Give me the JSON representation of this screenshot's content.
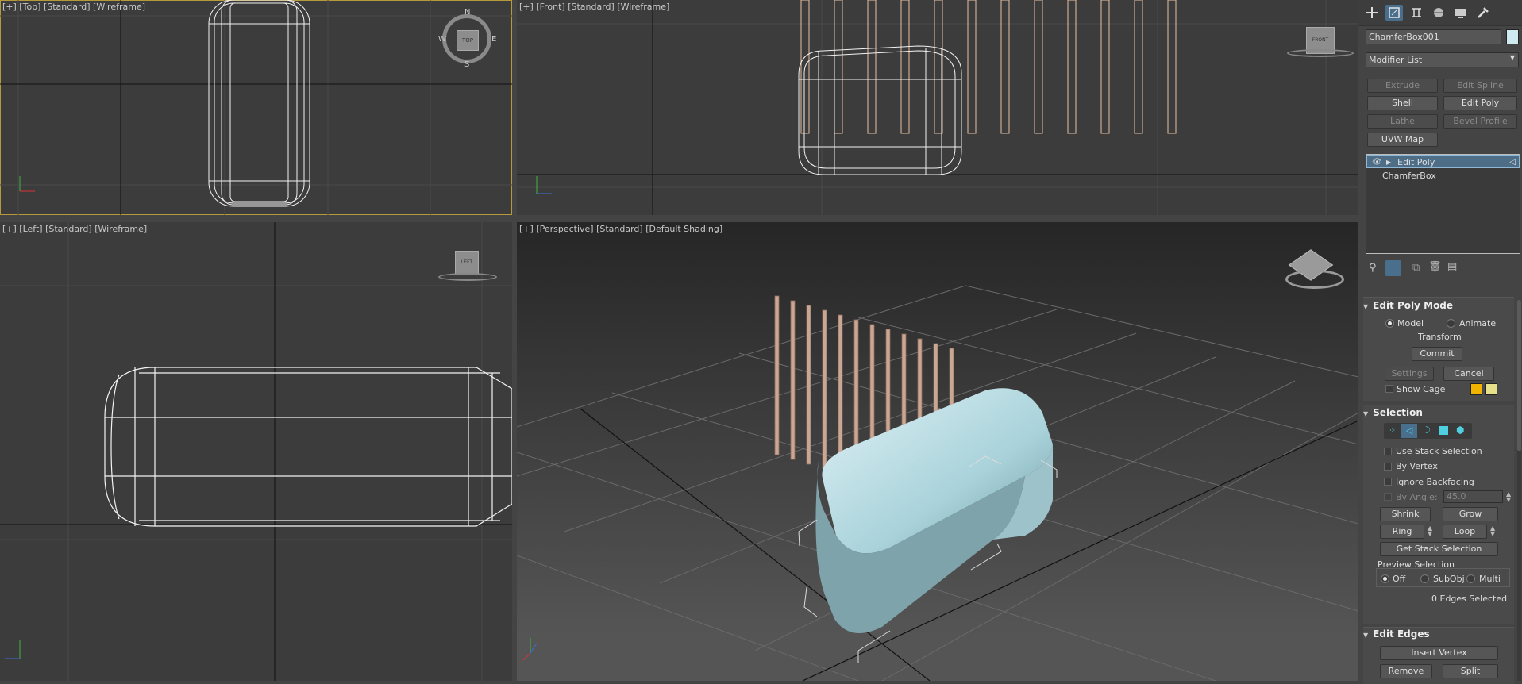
{
  "viewports": {
    "top": {
      "label": "[+] [Top] [Standard] [Wireframe]",
      "compass": {
        "n": "N",
        "s": "S",
        "e": "E",
        "w": "W",
        "cube": "TOP"
      }
    },
    "front": {
      "label": "[+] [Front] [Standard] [Wireframe]",
      "cube": "FRONT"
    },
    "left": {
      "label": "[+] [Left] [Standard] [Wireframe]",
      "cube": "LEFT"
    },
    "perspective": {
      "label": "[+] [Perspective] [Standard] [Default Shading]"
    }
  },
  "axes": {
    "x": "x",
    "y": "y",
    "z": "z"
  },
  "panel": {
    "object_name": "ChamferBox001",
    "object_color": "#cfe9f0",
    "modifier_list": "Modifier List",
    "modifier_buttons": [
      {
        "label": "Extrude",
        "enabled": false
      },
      {
        "label": "Edit Spline",
        "enabled": false
      },
      {
        "label": "Shell",
        "enabled": true
      },
      {
        "label": "Edit Poly",
        "enabled": true
      },
      {
        "label": "Lathe",
        "enabled": false
      },
      {
        "label": "Bevel Profile",
        "enabled": false
      },
      {
        "label": "UVW Map",
        "enabled": true
      }
    ],
    "stack": [
      "Edit Poly",
      "ChamferBox"
    ],
    "edit_poly_mode": {
      "title": "Edit Poly Mode",
      "model": "Model",
      "animate": "Animate",
      "transform": "Transform",
      "commit": "Commit",
      "settings": "Settings",
      "cancel": "Cancel",
      "show_cage": "Show Cage",
      "cage_colors": [
        "#f0b400",
        "#e7e08a"
      ]
    },
    "selection": {
      "title": "Selection",
      "use_stack": "Use Stack Selection",
      "by_vertex": "By Vertex",
      "ignore_backfacing": "Ignore Backfacing",
      "by_angle": "By Angle:",
      "angle_value": "45.0",
      "shrink": "Shrink",
      "grow": "Grow",
      "ring": "Ring",
      "loop": "Loop",
      "get_stack": "Get Stack Selection",
      "preview_title": "Preview Selection",
      "off": "Off",
      "subobj": "SubObj",
      "multi": "Multi",
      "status": "0 Edges Selected"
    },
    "edit_edges": {
      "title": "Edit Edges",
      "insert_vertex": "Insert Vertex",
      "remove": "Remove",
      "split": "Split"
    }
  }
}
